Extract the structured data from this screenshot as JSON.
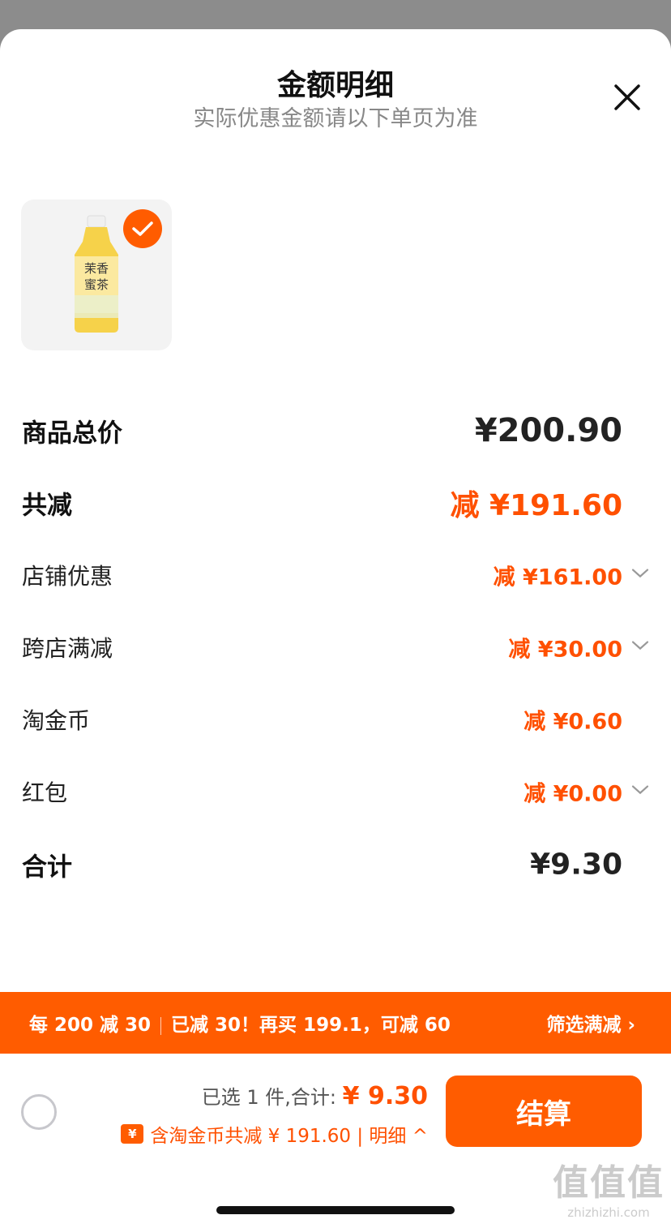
{
  "header": {
    "title": "金额明细",
    "subtitle": "实际优惠金额请以下单页为准"
  },
  "product": {
    "label_line1": "茉香",
    "label_line2": "蜜茶"
  },
  "rows": {
    "total": {
      "label": "商品总价",
      "value": "¥200.90"
    },
    "discount_total": {
      "label": "共减",
      "value": "减 ¥191.60"
    },
    "shop_discount": {
      "label": "店铺优惠",
      "value": "减 ¥161.00"
    },
    "cross_store": {
      "label": "跨店满减",
      "value": "减 ¥30.00"
    },
    "tao_coin": {
      "label": "淘金币",
      "value": "减 ¥0.60"
    },
    "red_packet": {
      "label": "红包",
      "value": "减 ¥0.00"
    },
    "sum": {
      "label": "合计",
      "value": "¥9.30"
    }
  },
  "promo": {
    "rule": "每 200 减 30",
    "status": "已减 30！再买 199.1，可减 60",
    "filter": "筛选满减 ›"
  },
  "footer": {
    "selected": "已选 1 件,合计:",
    "price": "¥ 9.30",
    "coin_icon": "¥",
    "detail": "含淘金币共减 ¥ 191.60 | 明细 ^",
    "checkout": "结算"
  },
  "watermark": {
    "big": "值值值",
    "small": "zhizhizhi.com"
  },
  "colors": {
    "accent": "#ff5c00",
    "discount_text": "#ff5000"
  }
}
